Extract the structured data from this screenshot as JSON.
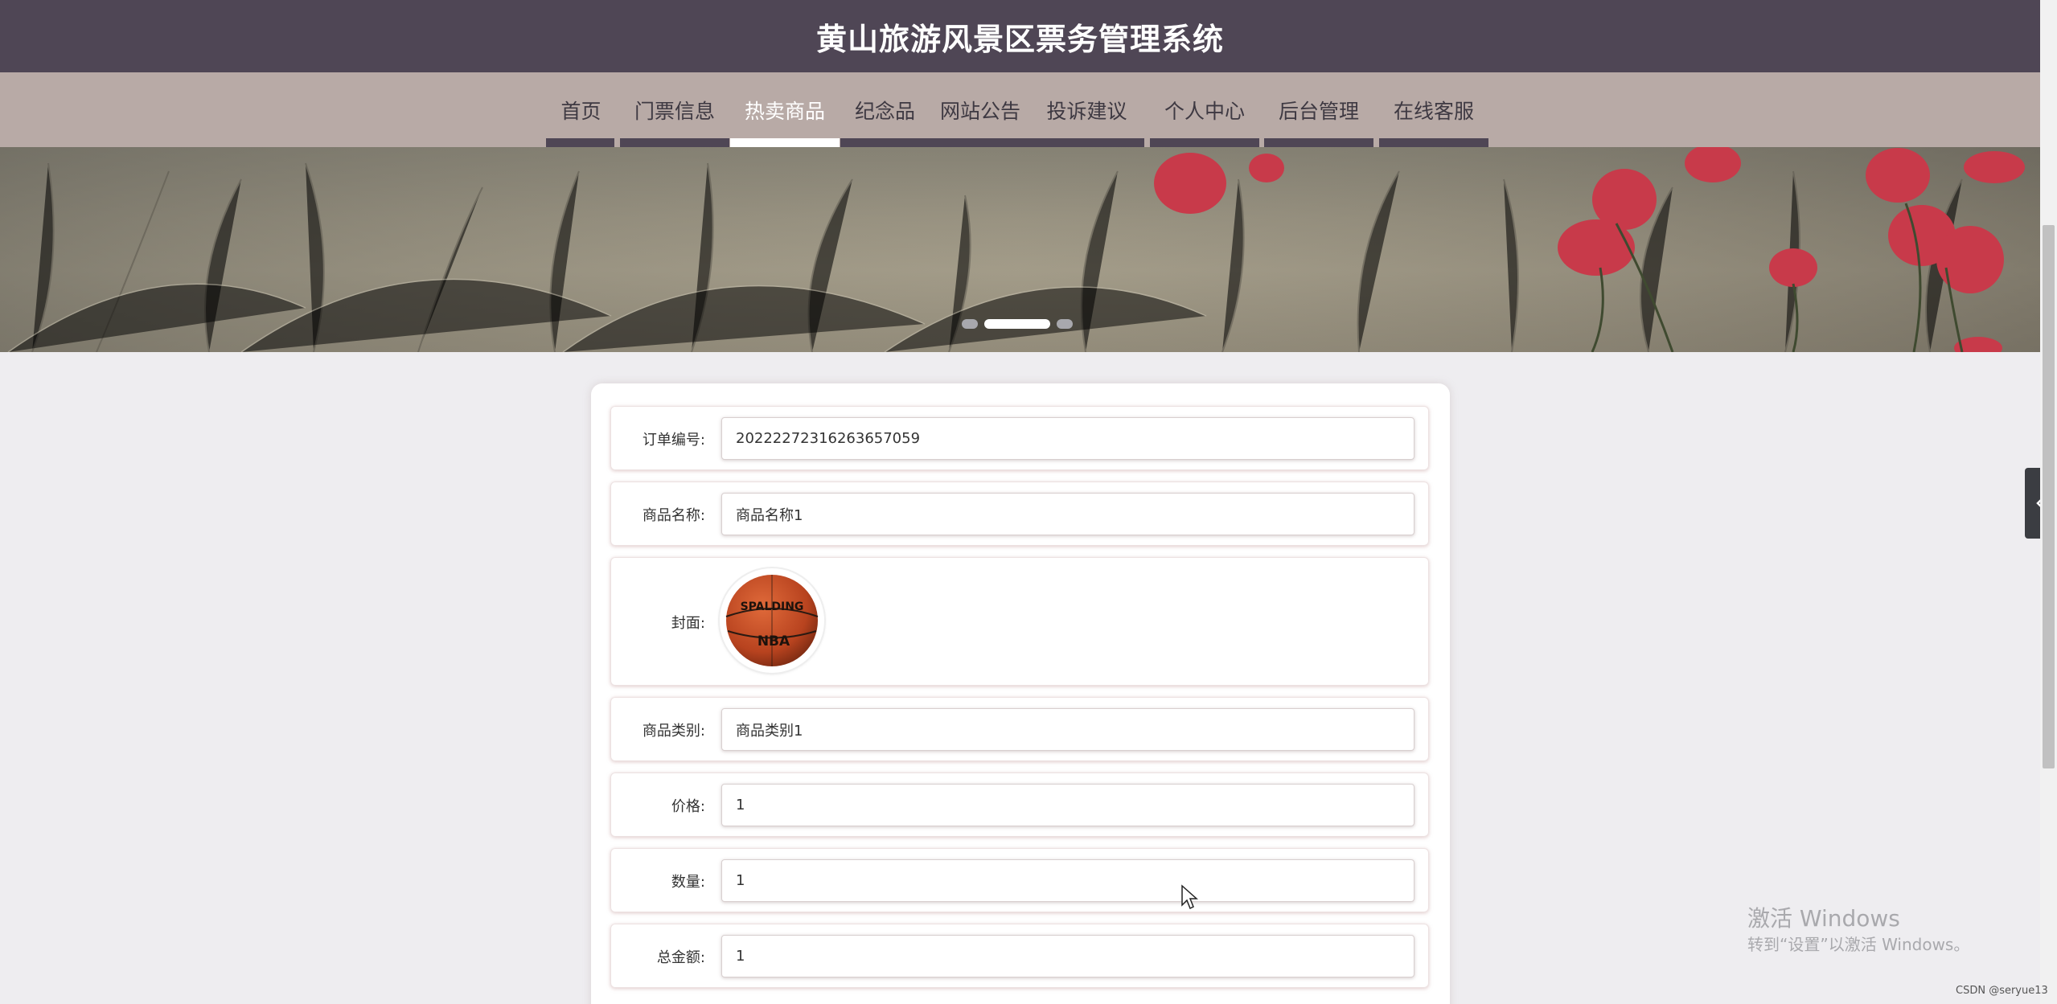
{
  "header": {
    "title": "黄山旅游风景区票务管理系统"
  },
  "nav": {
    "items": [
      {
        "label": "首页",
        "active": false
      },
      {
        "label": "门票信息",
        "active": false
      },
      {
        "label": "热卖商品",
        "active": true
      },
      {
        "label": "纪念品",
        "active": false
      },
      {
        "label": "网站公告",
        "active": false
      },
      {
        "label": "投诉建议",
        "active": false
      },
      {
        "label": "个人中心",
        "active": false
      },
      {
        "label": "后台管理",
        "active": false
      },
      {
        "label": "在线客服",
        "active": false
      }
    ]
  },
  "carousel": {
    "slide_count": 3,
    "active_index": 1
  },
  "form": {
    "order_no": {
      "label": "订单编号:",
      "value": "20222272316263657059"
    },
    "product_name": {
      "label": "商品名称:",
      "value": "商品名称1"
    },
    "cover": {
      "label": "封面:",
      "ball_brand": "SPALDING",
      "ball_league": "NBA"
    },
    "category": {
      "label": "商品类别:",
      "value": "商品类别1"
    },
    "price": {
      "label": "价格:",
      "value": "1"
    },
    "quantity": {
      "label": "数量:",
      "value": "1"
    },
    "total": {
      "label": "总金额:",
      "value": "1"
    }
  },
  "watermark": {
    "line1": "激活 Windows",
    "line2": "转到“设置”以激活 Windows。"
  },
  "credit": "CSDN @seryue13",
  "colors": {
    "header": "#4f4655",
    "nav": "#b8aaa6",
    "background": "#eeedf0"
  },
  "icons": {
    "side_tab": "chevron-left-icon"
  }
}
